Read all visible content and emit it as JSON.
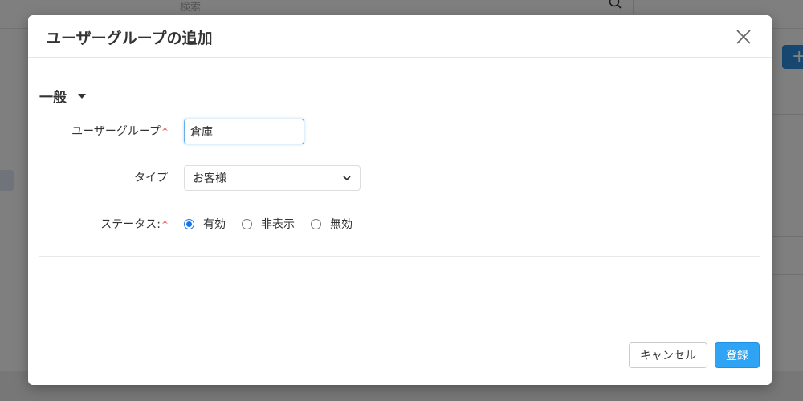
{
  "background": {
    "search_placeholder": "検索",
    "add_button_label": "+"
  },
  "modal": {
    "title": "ユーザーグループの追加",
    "section_title": "一般",
    "fields": {
      "user_group": {
        "label": "ユーザーグループ",
        "required_mark": "*",
        "value": "倉庫"
      },
      "type": {
        "label": "タイプ",
        "selected": "お客様"
      },
      "status": {
        "label": "ステータス:",
        "required_mark": "*",
        "options": [
          "有効",
          "非表示",
          "無効"
        ],
        "selected_index": 0
      }
    },
    "footer": {
      "cancel_label": "キャンセル",
      "submit_label": "登録"
    }
  },
  "colors": {
    "primary": "#2fa4f5",
    "required": "#e53935",
    "radio_checked": "#1a73e8"
  }
}
